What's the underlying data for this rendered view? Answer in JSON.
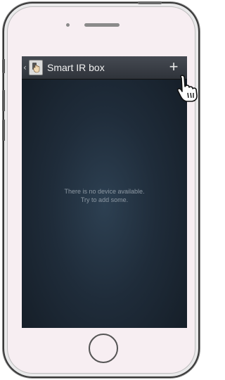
{
  "app": {
    "title": "Smart IR box",
    "back_icon": "chevron-left-icon",
    "app_icon": "hand-remote-icon",
    "add_icon": "plus-icon",
    "add_glyph": "+"
  },
  "content": {
    "empty_line1": "There is no device available.",
    "empty_line2": "Try to add some."
  },
  "overlay": {
    "cursor_icon": "pointing-hand-cursor-icon"
  },
  "colors": {
    "actionbar": "#3a3e45",
    "screen_bg": "#1f2c3a",
    "phone_body": "#f7eef2"
  }
}
